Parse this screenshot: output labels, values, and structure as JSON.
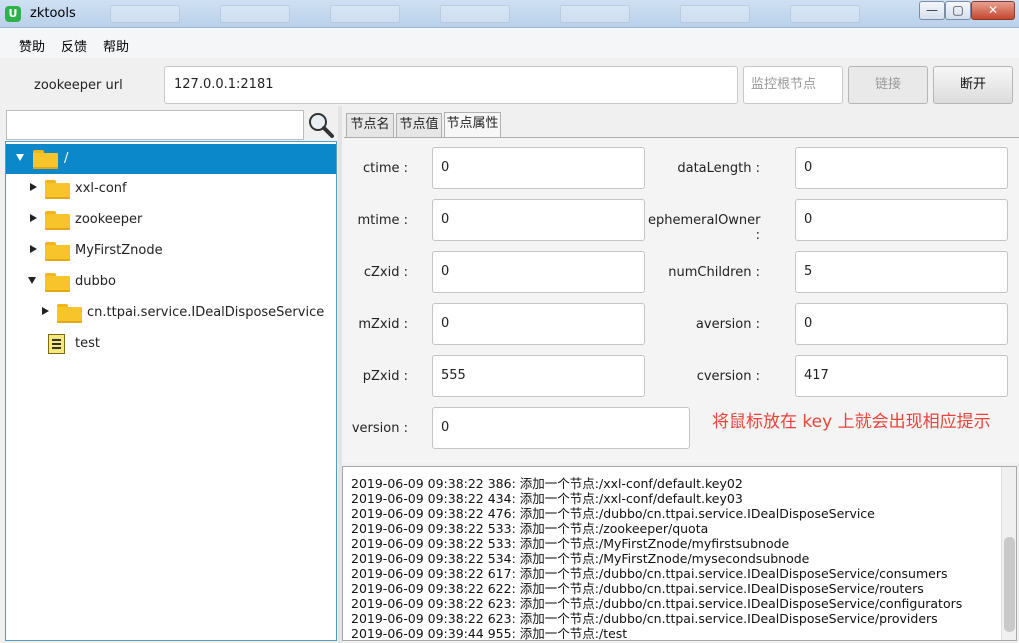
{
  "window": {
    "title": "zktools",
    "app_icon": "U",
    "minimize_glyph": "—",
    "maximize_glyph": "▢",
    "close_glyph": "✕"
  },
  "menu": [
    "赞助",
    "反馈",
    "帮助"
  ],
  "connection": {
    "url_label": "zookeeper url",
    "url_value": "127.0.0.1:2181",
    "root_placeholder": "监控根节点",
    "connect_label": "链接",
    "disconnect_label": "断开"
  },
  "tree": {
    "items": [
      {
        "label": "/",
        "expanded": true,
        "selected": true,
        "icon": "folder-icon"
      },
      {
        "label": "xxl-conf",
        "expanded": false,
        "icon": "folder-icon"
      },
      {
        "label": "zookeeper",
        "expanded": false,
        "icon": "folder-icon"
      },
      {
        "label": "MyFirstZnode",
        "expanded": false,
        "icon": "folder-icon"
      },
      {
        "label": "dubbo",
        "expanded": true,
        "icon": "folder-icon"
      },
      {
        "label": "cn.ttpai.service.IDealDisposeService",
        "expanded": false,
        "icon": "folder-icon"
      },
      {
        "label": "test",
        "icon": "file-icon"
      }
    ]
  },
  "tabs": [
    "节点名",
    "节点值",
    "节点属性"
  ],
  "active_tab": "节点属性",
  "properties": {
    "ctime": {
      "label": "ctime :",
      "value": "0"
    },
    "mtime": {
      "label": "mtime :",
      "value": "0"
    },
    "cZxid": {
      "label": "cZxid :",
      "value": "0"
    },
    "mZxid": {
      "label": "mZxid :",
      "value": "0"
    },
    "pZxid": {
      "label": "pZxid :",
      "value": "555"
    },
    "version": {
      "label": "version :",
      "value": "0"
    },
    "dataLength": {
      "label": "dataLength :",
      "value": "0"
    },
    "ephemeralOwner": {
      "label": "ephemeralOwner :",
      "value": "0"
    },
    "numChildren": {
      "label": "numChildren :",
      "value": "5"
    },
    "aversion": {
      "label": "aversion :",
      "value": "0"
    },
    "cversion": {
      "label": "cversion :",
      "value": "417"
    }
  },
  "hint": "将鼠标放在 key 上就会出现相应提示",
  "hint_color": "#e8443a",
  "selection_color": "#0a88c9",
  "log": [
    "2019-06-09 09:38:22 386: 添加一个节点:/xxl-conf/default.key02",
    "2019-06-09 09:38:22 434: 添加一个节点:/xxl-conf/default.key03",
    "2019-06-09 09:38:22 476: 添加一个节点:/dubbo/cn.ttpai.service.IDealDisposeService",
    "2019-06-09 09:38:22 533: 添加一个节点:/zookeeper/quota",
    "2019-06-09 09:38:22 533: 添加一个节点:/MyFirstZnode/myfirstsubnode",
    "2019-06-09 09:38:22 534: 添加一个节点:/MyFirstZnode/mysecondsubnode",
    "2019-06-09 09:38:22 617: 添加一个节点:/dubbo/cn.ttpai.service.IDealDisposeService/consumers",
    "2019-06-09 09:38:22 622: 添加一个节点:/dubbo/cn.ttpai.service.IDealDisposeService/routers",
    "2019-06-09 09:38:22 623: 添加一个节点:/dubbo/cn.ttpai.service.IDealDisposeService/configurators",
    "2019-06-09 09:38:22 623: 添加一个节点:/dubbo/cn.ttpai.service.IDealDisposeService/providers",
    "2019-06-09 09:39:44 955: 添加一个节点:/test"
  ]
}
